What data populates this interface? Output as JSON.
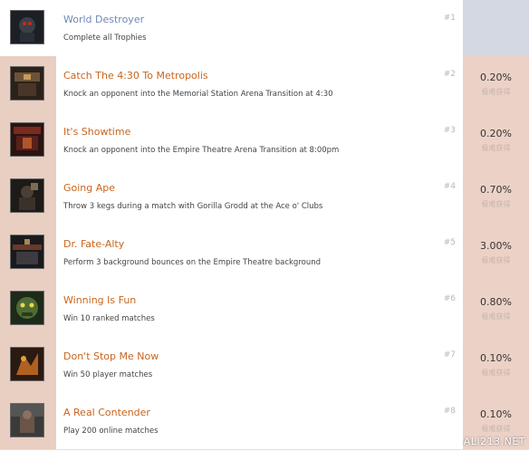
{
  "achievements": [
    {
      "title": "World Destroyer",
      "description": "Complete all Trophies",
      "rank": "#1",
      "percent": "",
      "sub": ""
    },
    {
      "title": "Catch The 4:30 To Metropolis",
      "description": "Knock an opponent into the Memorial Station Arena Transition at 4:30",
      "rank": "#2",
      "percent": "0.20%",
      "sub": "极难获得"
    },
    {
      "title": "It's Showtime",
      "description": "Knock an opponent into the Empire Theatre Arena Transition at 8:00pm",
      "rank": "#3",
      "percent": "0.20%",
      "sub": "极难获得"
    },
    {
      "title": "Going Ape",
      "description": "Throw 3 kegs during a match with Gorilla Grodd at the Ace o' Clubs",
      "rank": "#4",
      "percent": "0.70%",
      "sub": "极难获得"
    },
    {
      "title": "Dr. Fate-Alty",
      "description": "Perform 3 background bounces on the Empire Theatre background",
      "rank": "#5",
      "percent": "3.00%",
      "sub": "极难获得"
    },
    {
      "title": "Winning Is Fun",
      "description": "Win 10 ranked matches",
      "rank": "#6",
      "percent": "0.80%",
      "sub": "极难获得"
    },
    {
      "title": "Don't Stop Me Now",
      "description": "Win 50 player matches",
      "rank": "#7",
      "percent": "0.10%",
      "sub": "极难获得"
    },
    {
      "title": "A Real Contender",
      "description": "Play 200 online matches",
      "rank": "#8",
      "percent": "0.10%",
      "sub": "极难获得"
    }
  ],
  "watermark": "ALI213.NET",
  "colors": {
    "title_orange": "#c8651f",
    "title_blue": "#7088b8",
    "side_peach": "#ecd2c6",
    "side_blue": "#d4d8e3"
  }
}
